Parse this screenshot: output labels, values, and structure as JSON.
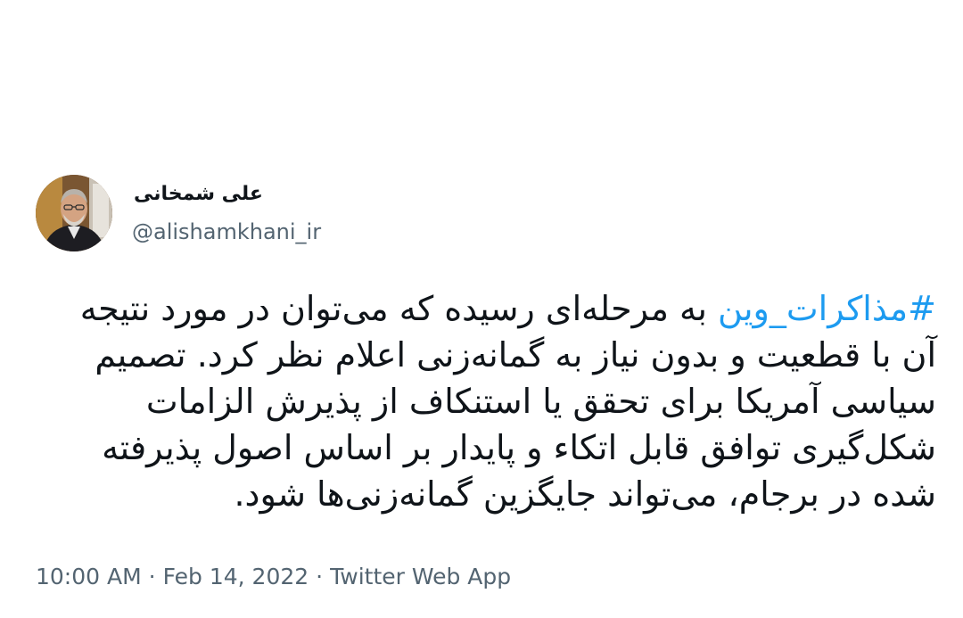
{
  "author": {
    "display_name": "علی شمخانی",
    "handle": "@alishamkhani_ir"
  },
  "tweet": {
    "hashtag": "#مذاکرات_وین",
    "text": "به مرحله‌ای رسیده که می‌توان در مورد نتیجه آن با قطعیت و بدون نیاز به گمانه‌زنی اعلام نظر کرد. تصمیم سیاسی آمریکا برای تحقق یا استنکاف از پذیرش الزامات شکل‌گیری توافق قابل اتکاء و پایدار بر اساس اصول پذیرفته شده در برجام، می‌تواند جایگزین گمانه‌زنی‌ها شود."
  },
  "meta": {
    "time": "10:00 AM",
    "separator": "·",
    "date": "Feb 14, 2022",
    "source": "Twitter Web App"
  },
  "colors": {
    "link": "#1d9bf0",
    "text": "#0f1419",
    "secondary": "#536471"
  }
}
